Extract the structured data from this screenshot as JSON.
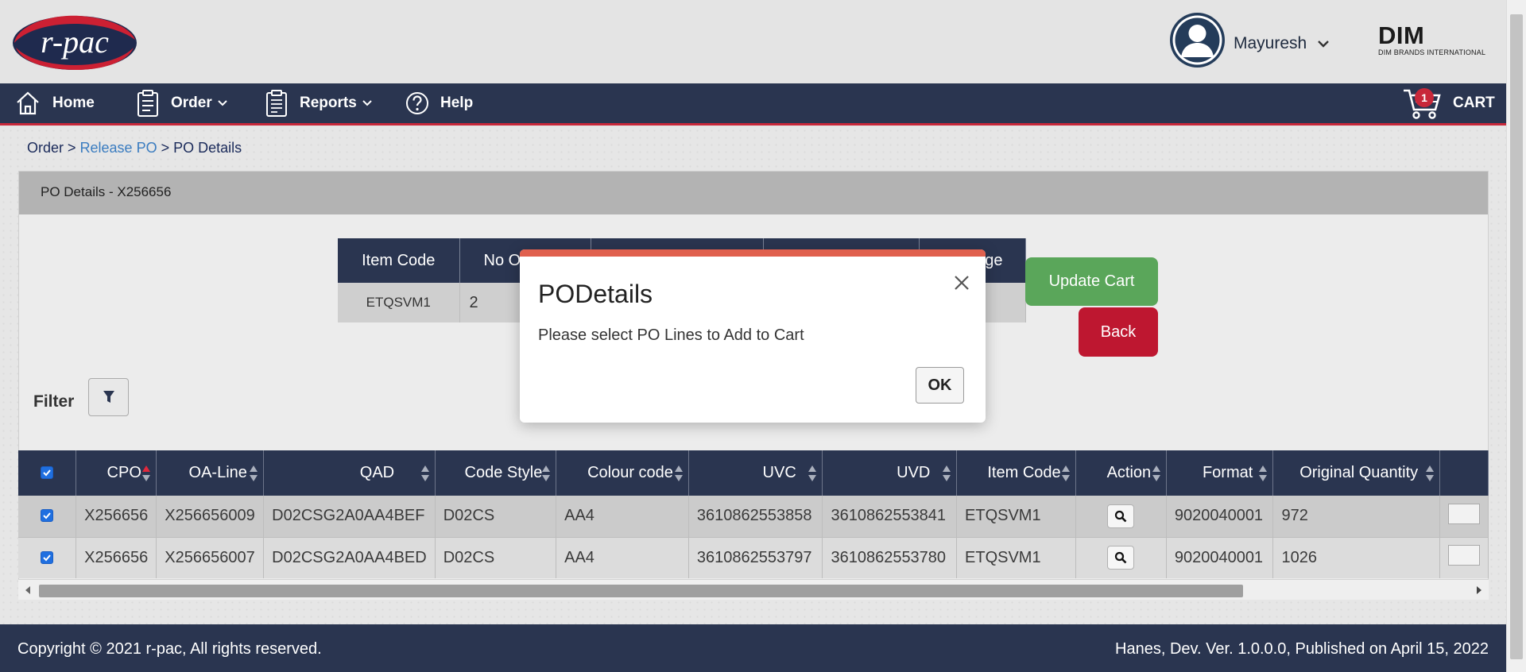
{
  "header": {
    "logo_text": "r-pac",
    "user_name": "Mayuresh",
    "brand_big": "DIM",
    "brand_small": "DIM BRANDS INTERNATIONAL"
  },
  "nav": {
    "home": "Home",
    "order": "Order",
    "reports": "Reports",
    "help": "Help",
    "cart": "CART",
    "cart_count": "1"
  },
  "breadcrumb": {
    "order": "Order",
    "sep1": " > ",
    "release_po": "Release PO",
    "sep2": " > ",
    "po_details": "PO Details"
  },
  "panel": {
    "title": "PO Details - X256656"
  },
  "summary": {
    "headers": [
      "Item Code",
      "No O",
      "",
      "",
      "ge"
    ],
    "row": [
      "ETQSVM1",
      "2",
      "",
      "",
      ""
    ]
  },
  "buttons": {
    "update_cart": "Update Cart",
    "back": "Back"
  },
  "filter": {
    "label": "Filter"
  },
  "grid": {
    "headers": [
      "CPO",
      "OA-Line",
      "QAD",
      "Code Style",
      "Colour code",
      "UVC",
      "UVD",
      "Item Code",
      "Action",
      "Format",
      "Original Quantity"
    ],
    "rows": [
      [
        "X256656",
        "X256656009",
        "D02CSG2A0AA4BEF",
        "D02CS",
        "AA4",
        "3610862553858",
        "3610862553841",
        "ETQSVM1",
        "",
        "9020040001",
        "972"
      ],
      [
        "X256656",
        "X256656007",
        "D02CSG2A0AA4BED",
        "D02CS",
        "AA4",
        "3610862553797",
        "3610862553780",
        "ETQSVM1",
        "",
        "9020040001",
        "1026"
      ]
    ]
  },
  "footer": {
    "copyright": "Copyright © 2021 r-pac, All rights reserved.",
    "version": "Hanes, Dev. Ver. 1.0.0.0, Published on April 15, 2022"
  },
  "modal": {
    "title": "PODetails",
    "message": "Please select PO Lines to Add to Cart",
    "ok": "OK"
  },
  "colors": {
    "nav_bg": "#2a3550",
    "accent_red": "#c8283a",
    "update_green": "#5aa65a",
    "back_red": "#be1730",
    "modal_bar": "#e0604e"
  },
  "icons": [
    "home-icon",
    "clipboard-icon",
    "report-icon",
    "help-icon",
    "cart-icon",
    "filter-icon",
    "search-icon",
    "user-avatar-icon",
    "close-icon",
    "chevron-down-icon",
    "sort-icon"
  ]
}
